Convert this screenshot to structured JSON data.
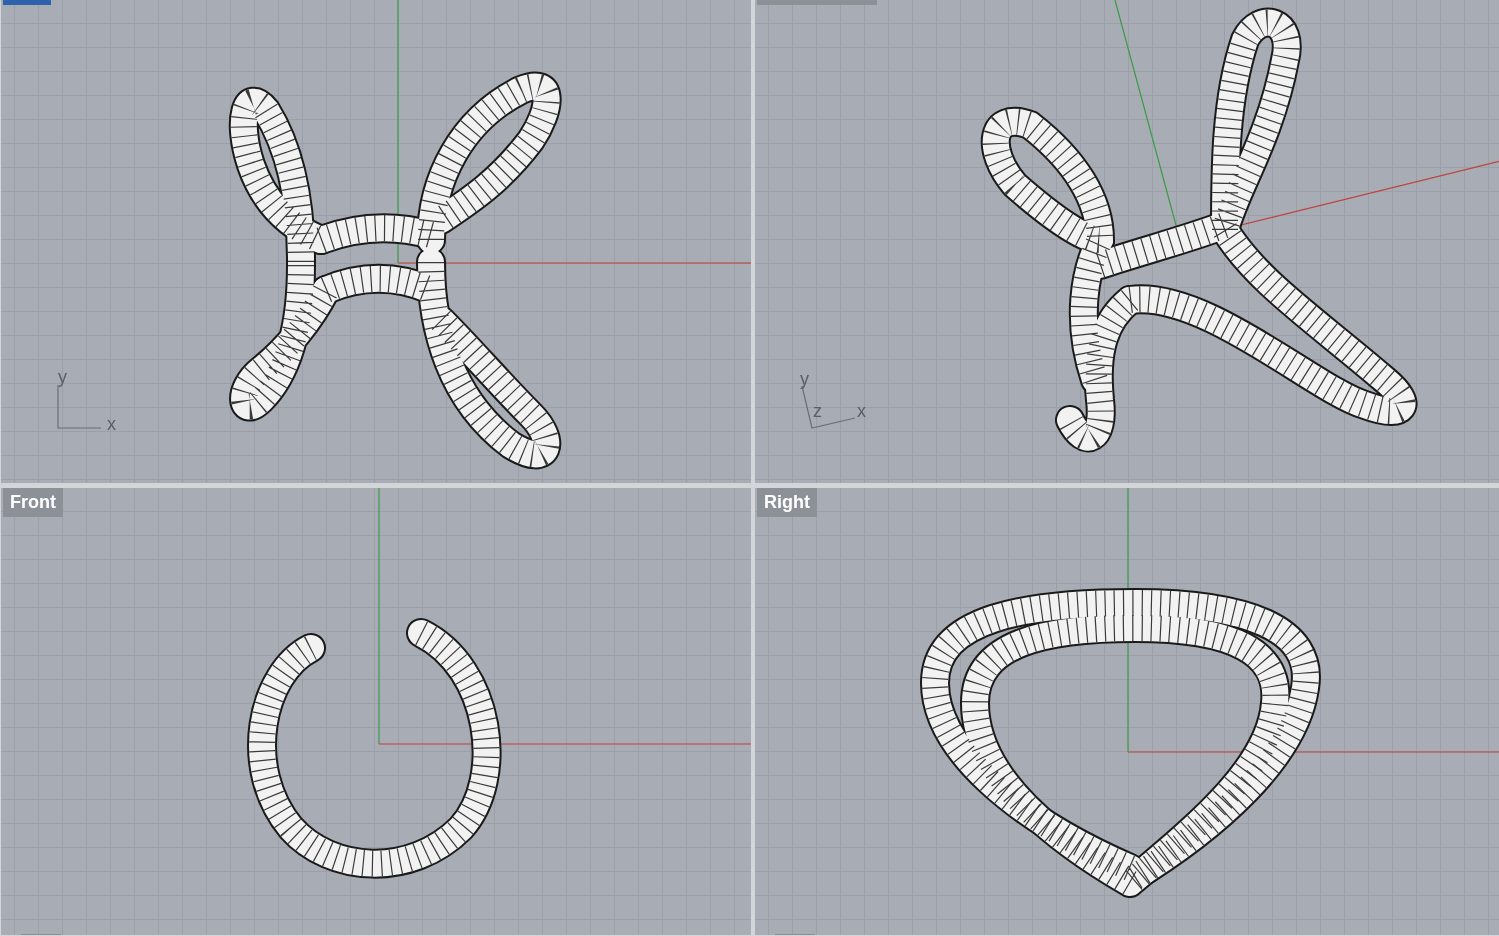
{
  "viewports": [
    {
      "kind": "top",
      "selected": true,
      "axis_labels": [
        "y",
        "x"
      ]
    },
    {
      "kind": "perspective",
      "selected": false,
      "axis_labels": [
        "y",
        "z",
        "x"
      ]
    },
    {
      "kind": "front",
      "title": "Front",
      "selected": false
    },
    {
      "kind": "right",
      "title": "Right",
      "selected": false
    }
  ]
}
